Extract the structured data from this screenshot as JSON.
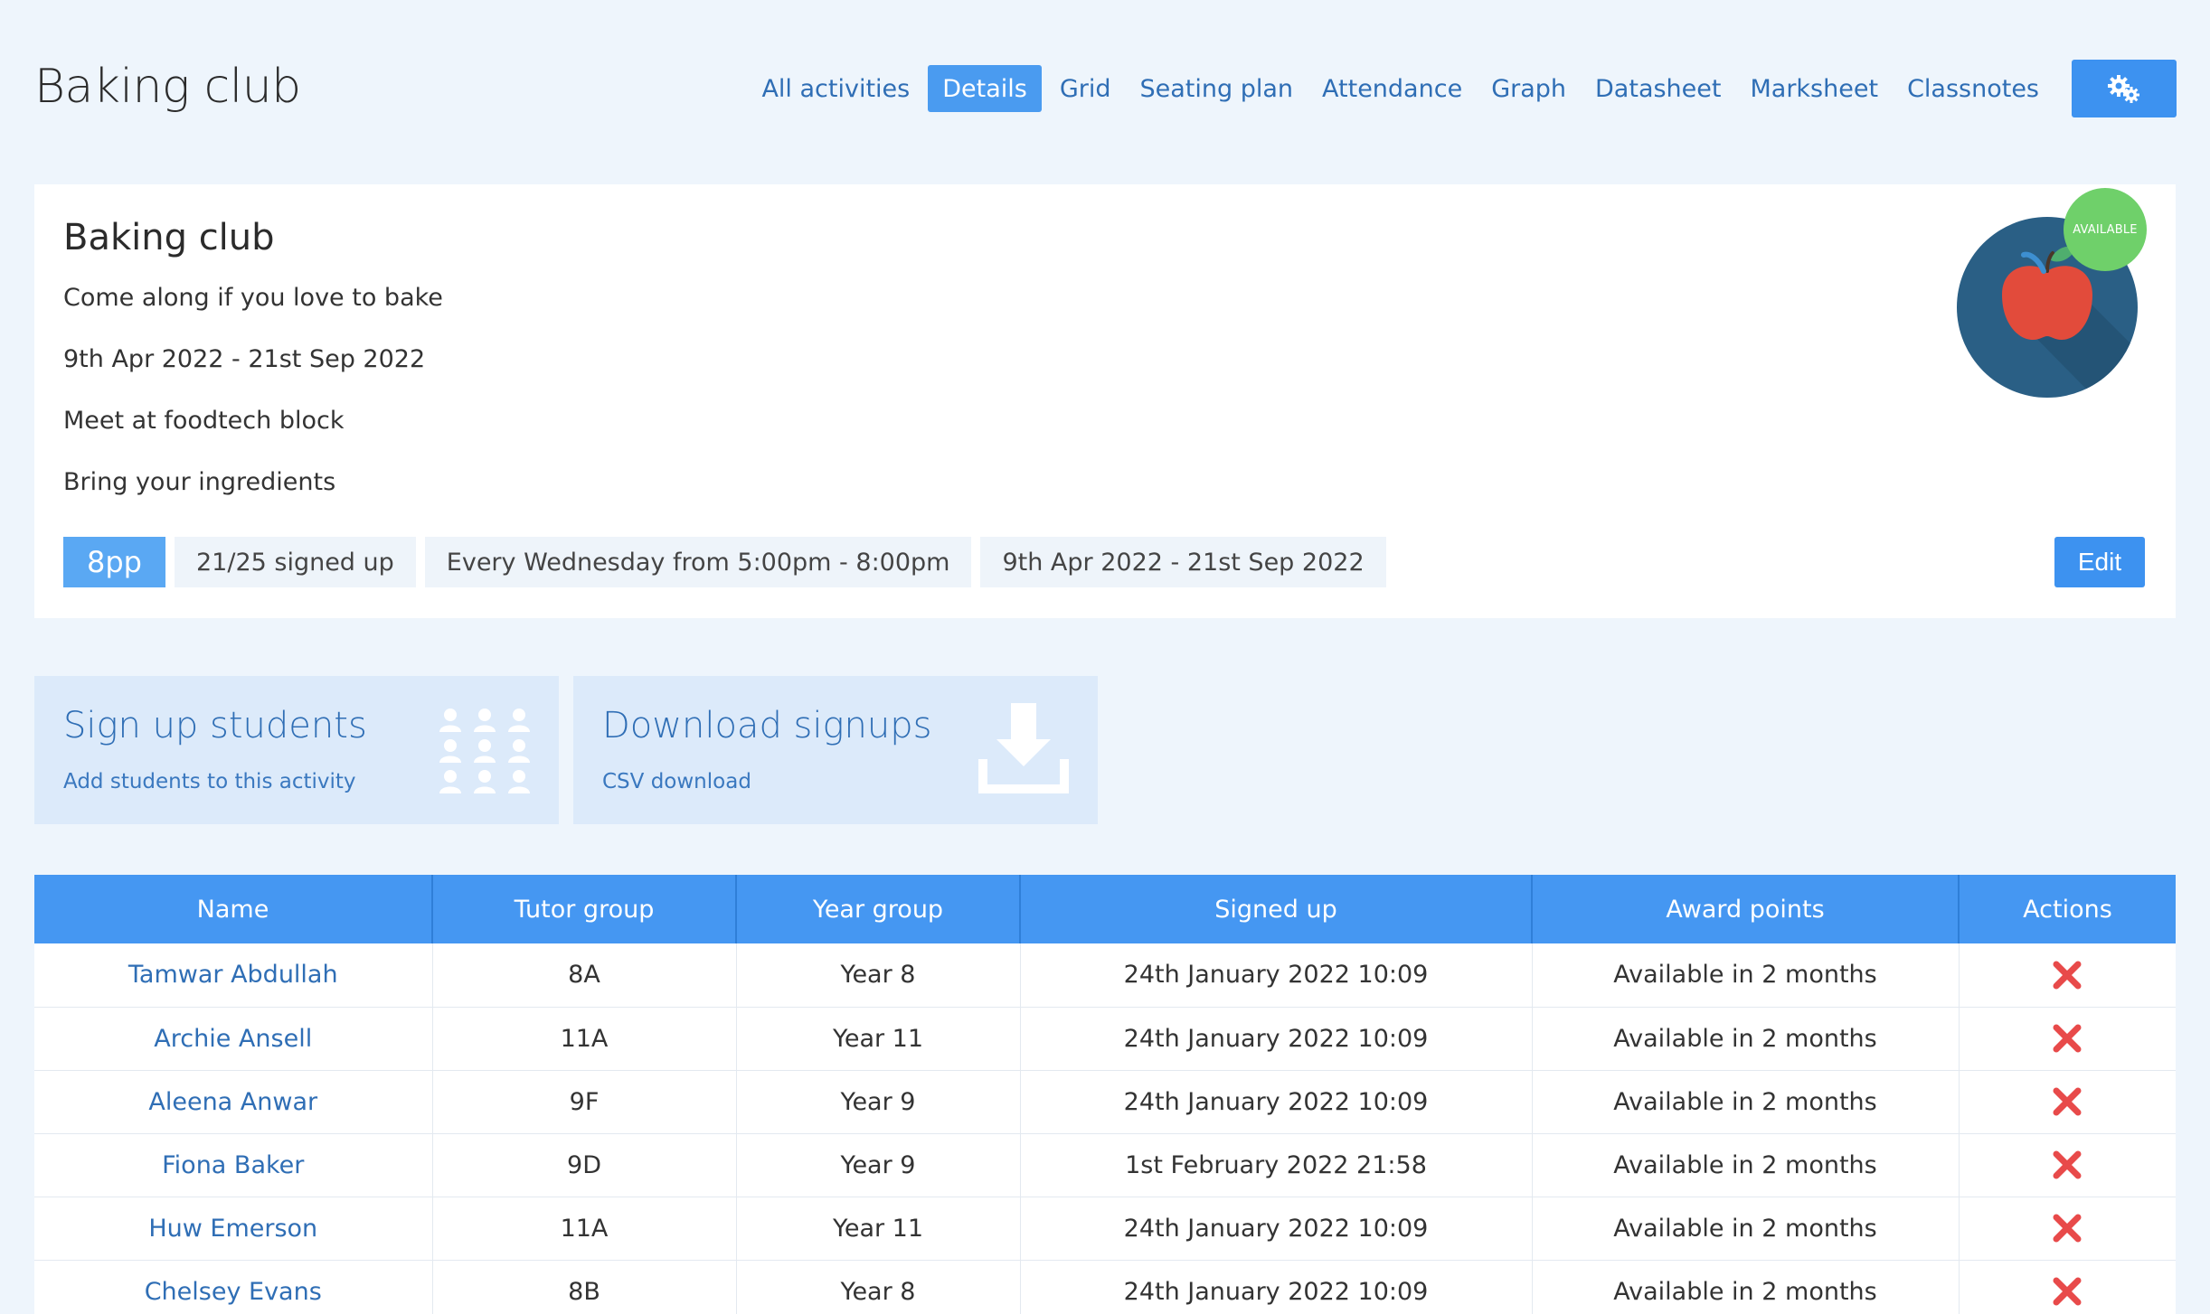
{
  "header": {
    "title": "Baking club",
    "tabs": [
      {
        "label": "All activities"
      },
      {
        "label": "Details",
        "active": true
      },
      {
        "label": "Grid"
      },
      {
        "label": "Seating plan"
      },
      {
        "label": "Attendance"
      },
      {
        "label": "Graph"
      },
      {
        "label": "Datasheet"
      },
      {
        "label": "Marksheet"
      },
      {
        "label": "Classnotes"
      }
    ],
    "settings_icon": "gears-icon"
  },
  "details": {
    "title": "Baking club",
    "description": "Come along if you love to bake",
    "date_range": "9th Apr 2022 - 21st Sep 2022",
    "location": "Meet at foodtech block",
    "note": "Bring your ingredients",
    "status_badge": "AVAILABLE",
    "logo_icon": "apple-icon",
    "pills": {
      "points": "8pp",
      "signed_up": "21/25 signed up",
      "schedule": "Every Wednesday from 5:00pm - 8:00pm",
      "dates": "9th Apr 2022 - 21st Sep 2022"
    },
    "edit_label": "Edit"
  },
  "actions": {
    "signup": {
      "title": "Sign up students",
      "subtitle": "Add students to this activity",
      "icon": "students-icon"
    },
    "download": {
      "title": "Download signups",
      "subtitle": "CSV download",
      "icon": "download-icon"
    }
  },
  "table": {
    "headers": {
      "name": "Name",
      "tutor": "Tutor group",
      "year": "Year group",
      "signed": "Signed up",
      "award": "Award points",
      "actions": "Actions"
    },
    "rows": [
      {
        "name": "Tamwar Abdullah",
        "tutor": "8A",
        "year": "Year 8",
        "signed": "24th January 2022 10:09",
        "award": "Available in 2 months"
      },
      {
        "name": "Archie Ansell",
        "tutor": "11A",
        "year": "Year 11",
        "signed": "24th January 2022 10:09",
        "award": "Available in 2 months"
      },
      {
        "name": "Aleena Anwar",
        "tutor": "9F",
        "year": "Year 9",
        "signed": "24th January 2022 10:09",
        "award": "Available in 2 months"
      },
      {
        "name": "Fiona Baker",
        "tutor": "9D",
        "year": "Year 9",
        "signed": "1st February 2022 21:58",
        "award": "Available in 2 months"
      },
      {
        "name": "Huw Emerson",
        "tutor": "11A",
        "year": "Year 11",
        "signed": "24th January 2022 10:09",
        "award": "Available in 2 months"
      },
      {
        "name": "Chelsey Evans",
        "tutor": "8B",
        "year": "Year 8",
        "signed": "24th January 2022 10:09",
        "award": "Available in 2 months"
      }
    ]
  },
  "colors": {
    "accent": "#3d92f0",
    "link": "#2f6eb5",
    "available_green": "#6fd06a",
    "remove_red": "#e84a4a"
  }
}
